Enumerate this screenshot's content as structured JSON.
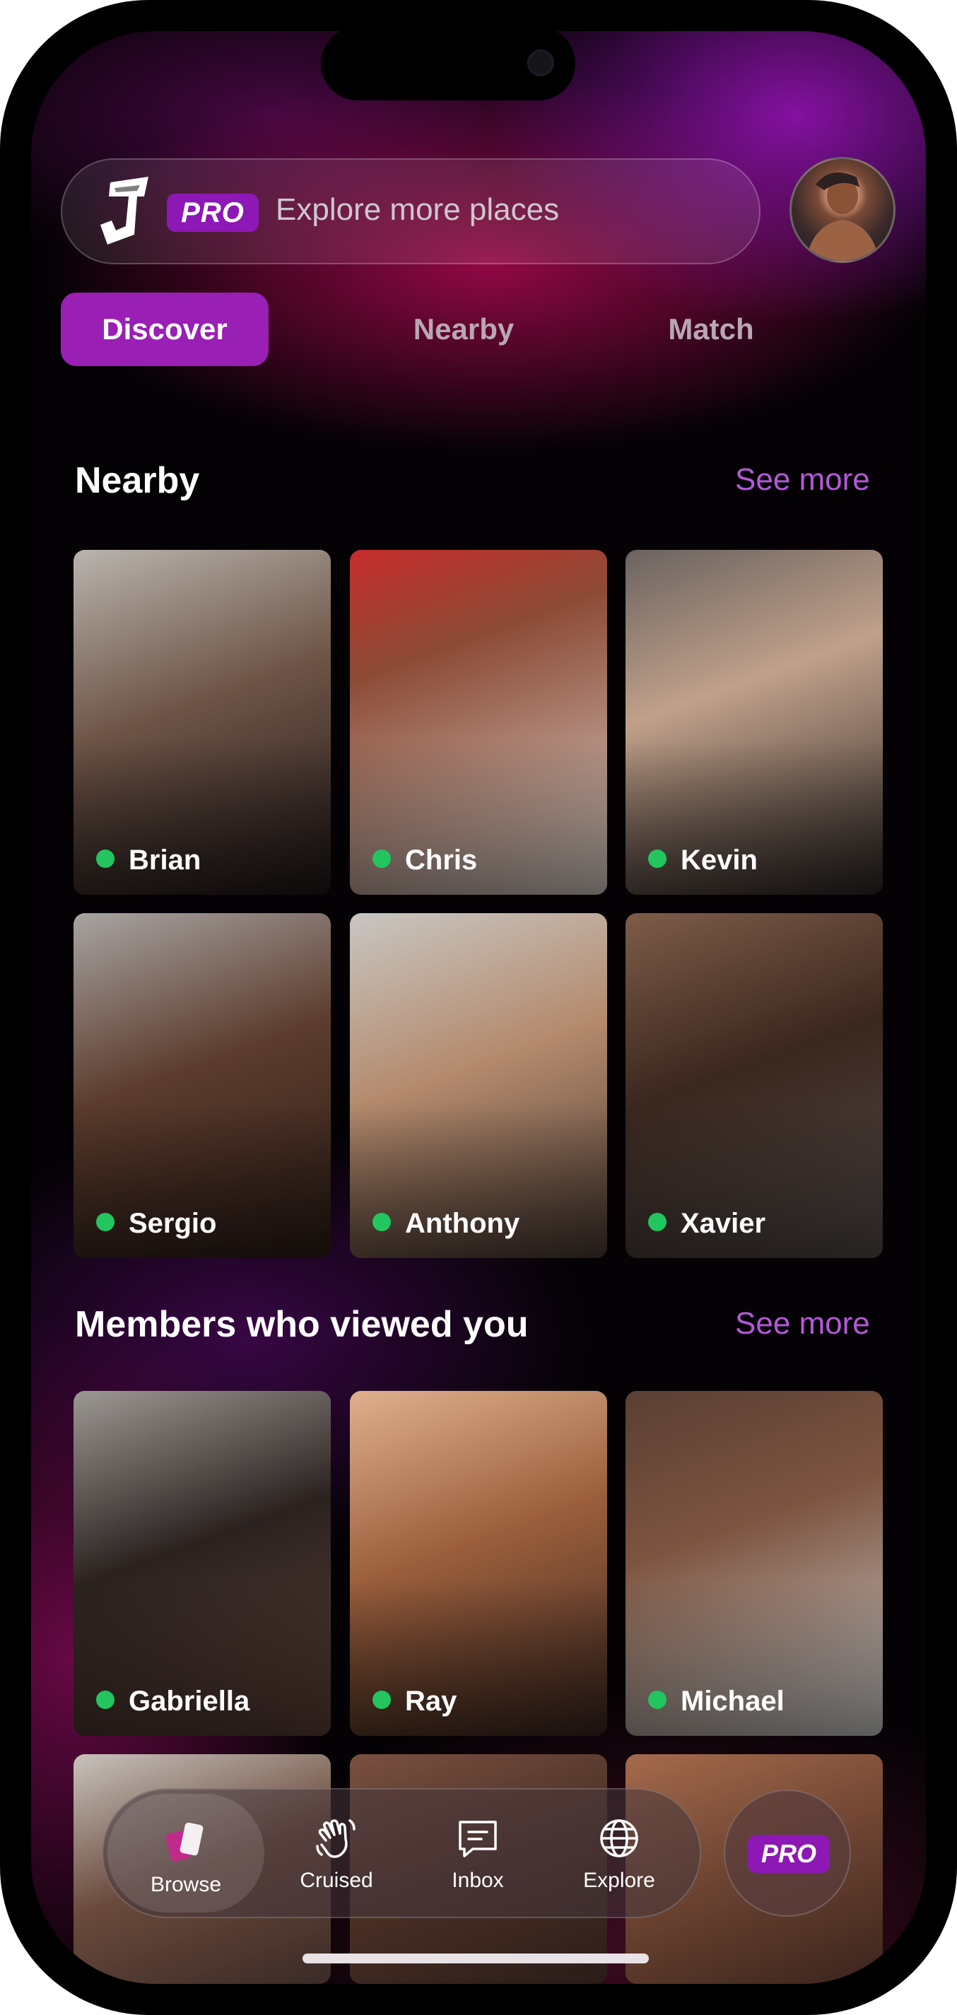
{
  "header": {
    "pro_badge": "PRO",
    "search_placeholder": "Explore more places"
  },
  "tabs": [
    {
      "label": "Discover",
      "active": true
    },
    {
      "label": "Nearby",
      "active": false
    },
    {
      "label": "Match",
      "active": false
    }
  ],
  "sections": {
    "nearby": {
      "title": "Nearby",
      "see_more": "See more",
      "members": [
        {
          "name": "Brian",
          "online": true
        },
        {
          "name": "Chris",
          "online": true
        },
        {
          "name": "Kevin",
          "online": true
        },
        {
          "name": "Sergio",
          "online": true
        },
        {
          "name": "Anthony",
          "online": true
        },
        {
          "name": "Xavier",
          "online": true
        }
      ]
    },
    "viewed": {
      "title": "Members who viewed you",
      "see_more": "See more",
      "members": [
        {
          "name": "Gabriella",
          "online": true
        },
        {
          "name": "Ray",
          "online": true
        },
        {
          "name": "Michael",
          "online": true
        }
      ]
    }
  },
  "nav": {
    "items": [
      {
        "label": "Browse",
        "icon": "browse-icon",
        "active": true
      },
      {
        "label": "Cruised",
        "icon": "hand-wave-icon",
        "active": false
      },
      {
        "label": "Inbox",
        "icon": "chat-icon",
        "active": false
      },
      {
        "label": "Explore",
        "icon": "globe-icon",
        "active": false
      }
    ],
    "pro_label": "PRO"
  },
  "colors": {
    "accent": "#9a1fb4",
    "link": "#b458d8",
    "online": "#22c55e"
  }
}
